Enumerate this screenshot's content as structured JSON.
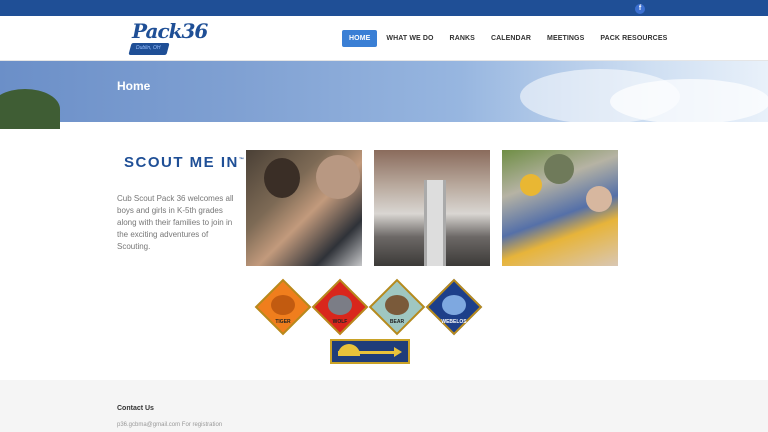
{
  "topbar": {
    "facebook_icon": "facebook-icon",
    "facebook_glyph": "f"
  },
  "header": {
    "logo_text": "Pack36",
    "logo_sub": "Dublin, OH",
    "nav": [
      "HOME",
      "WHAT WE DO",
      "RANKS",
      "CALENDAR",
      "MEETINGS",
      "PACK RESOURCES"
    ],
    "active": "HOME"
  },
  "banner": {
    "title": "Home"
  },
  "main": {
    "scout_title": "SCOUT ME IN",
    "trademark": "™",
    "welcome": "Cub Scout Pack 36 welcomes all boys and girls in K-5th grades along with their families to join in the exciting adventures of Scouting.",
    "badges": [
      "TIGER",
      "WOLF",
      "BEAR",
      "WEBELOS"
    ]
  },
  "footer": {
    "heading": "Contact Us",
    "email_line": "p36.gcbma@gmail.com For registration"
  },
  "colors": {
    "brand_blue": "#1f4f96",
    "nav_active": "#3a7fd5"
  }
}
